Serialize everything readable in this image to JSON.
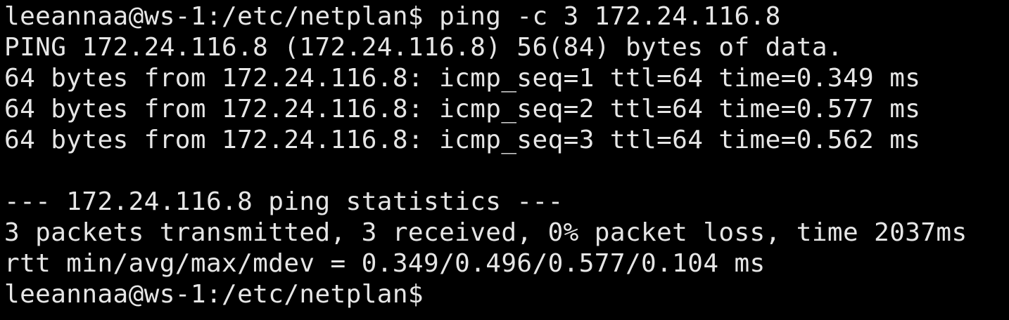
{
  "terminal": {
    "background_color": "#000000",
    "text_color": "#e6e6e6",
    "lines": [
      "leeannaa@ws-1:/etc/netplan$ ping -c 3 172.24.116.8",
      "PING 172.24.116.8 (172.24.116.8) 56(84) bytes of data.",
      "64 bytes from 172.24.116.8: icmp_seq=1 ttl=64 time=0.349 ms",
      "64 bytes from 172.24.116.8: icmp_seq=2 ttl=64 time=0.577 ms",
      "64 bytes from 172.24.116.8: icmp_seq=3 ttl=64 time=0.562 ms",
      "",
      "--- 172.24.116.8 ping statistics ---",
      "3 packets transmitted, 3 received, 0% packet loss, time 2037ms",
      "rtt min/avg/max/mdev = 0.349/0.496/0.577/0.104 ms",
      "leeannaa@ws-1:/etc/netplan$"
    ]
  }
}
